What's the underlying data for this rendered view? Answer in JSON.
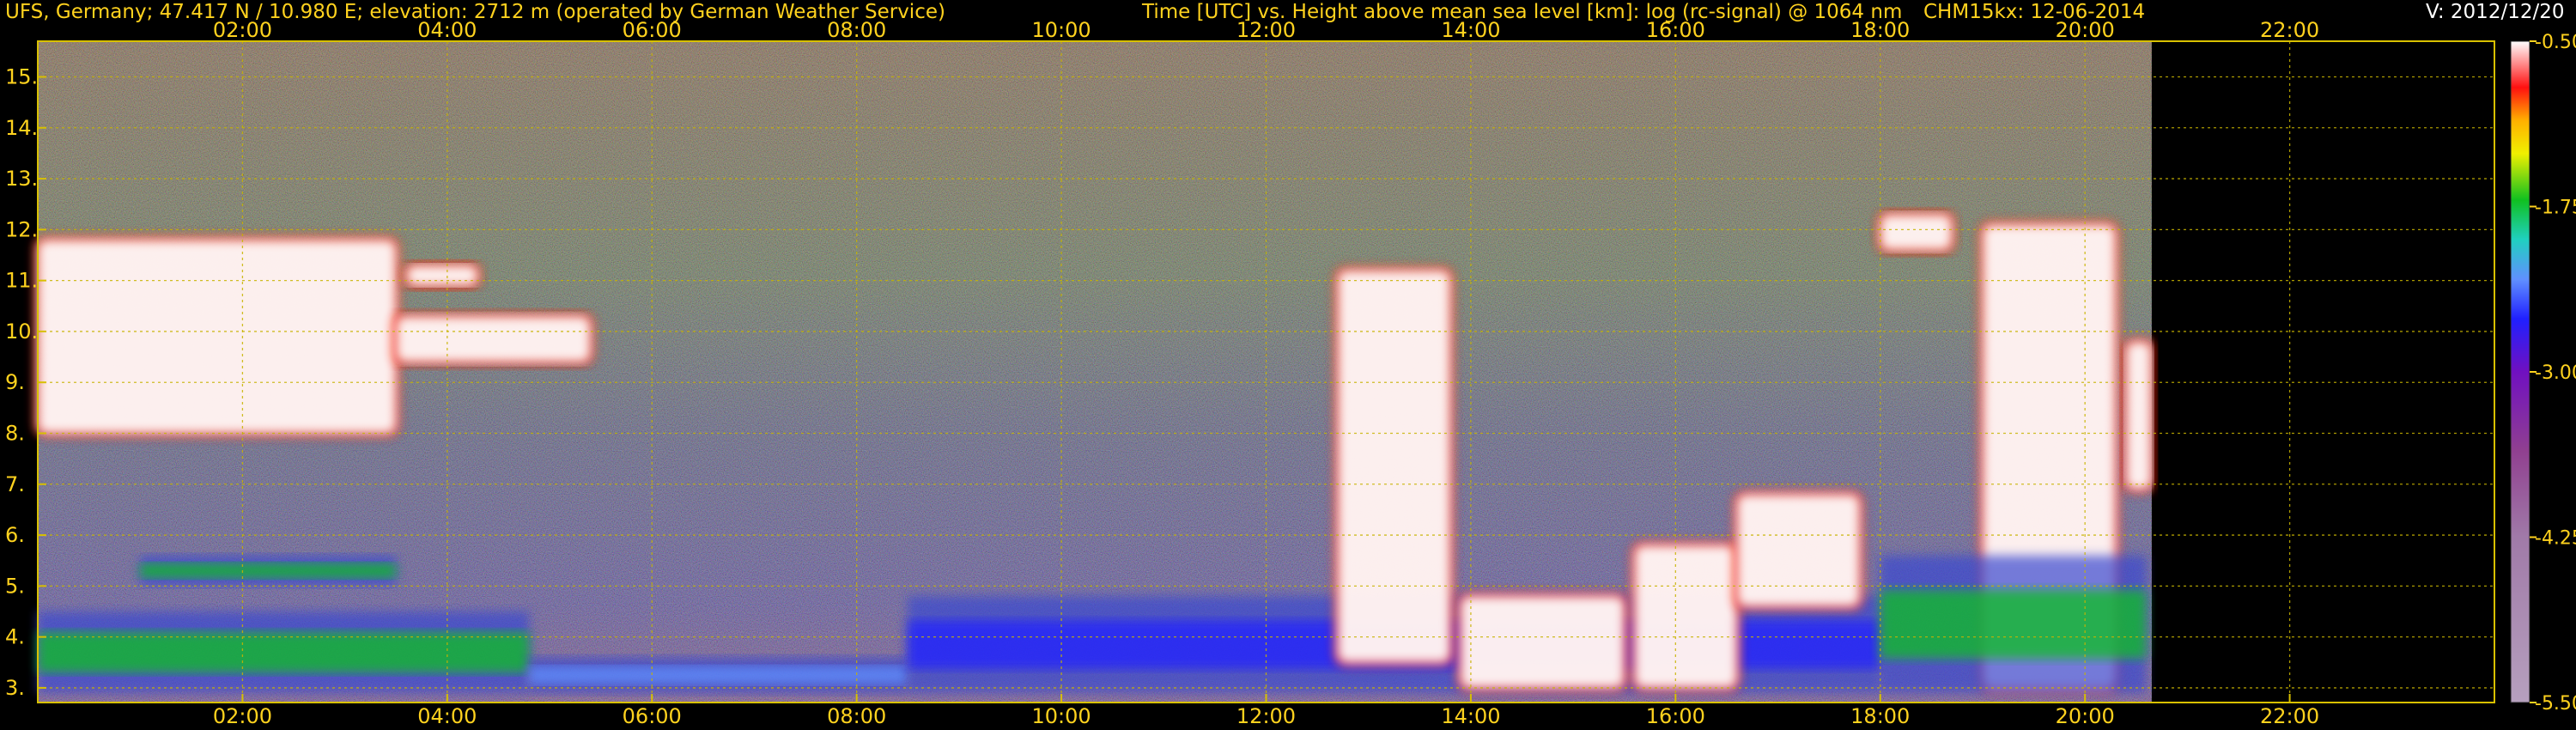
{
  "header": {
    "station": "UFS, Germany; 47.417 N / 10.980 E; elevation: 2712 m  (operated by German Weather Service)",
    "plot_title": "Time [UTC] vs. Height above mean sea level [km]: log (rc-signal) @ 1064 nm",
    "instrument_date": "CHM15kx: 12-06-2014",
    "version": "V: 2012/12/20"
  },
  "chart_data": {
    "type": "heatmap",
    "title": "Time [UTC] vs. Height above mean sea level [km]: log (rc-signal) @ 1064 nm",
    "xlabel": "Time [UTC]",
    "ylabel": "Height above mean sea level [km]",
    "x_unit": "hours UTC",
    "xlim": [
      0.0,
      24.0
    ],
    "ylim": [
      2.712,
      15.7
    ],
    "x_ticks": [
      {
        "value": 2,
        "label": "02:00"
      },
      {
        "value": 4,
        "label": "04:00"
      },
      {
        "value": 6,
        "label": "06:00"
      },
      {
        "value": 8,
        "label": "08:00"
      },
      {
        "value": 10,
        "label": "10:00"
      },
      {
        "value": 12,
        "label": "12:00"
      },
      {
        "value": 14,
        "label": "14:00"
      },
      {
        "value": 16,
        "label": "16:00"
      },
      {
        "value": 18,
        "label": "18:00"
      },
      {
        "value": 20,
        "label": "20:00"
      },
      {
        "value": 22,
        "label": "22:00"
      }
    ],
    "y_ticks": [
      {
        "value": 3,
        "label": "3."
      },
      {
        "value": 4,
        "label": "4."
      },
      {
        "value": 5,
        "label": "5."
      },
      {
        "value": 6,
        "label": "6."
      },
      {
        "value": 7,
        "label": "7."
      },
      {
        "value": 8,
        "label": "8."
      },
      {
        "value": 9,
        "label": "9."
      },
      {
        "value": 10,
        "label": "10."
      },
      {
        "value": 11,
        "label": "11."
      },
      {
        "value": 12,
        "label": "12."
      },
      {
        "value": 13,
        "label": "13."
      },
      {
        "value": 14,
        "label": "14."
      },
      {
        "value": 15,
        "label": "15."
      }
    ],
    "grid": true,
    "data_end_time": 20.65,
    "colorbar": {
      "range": [
        -5.5,
        -0.5
      ],
      "ticks": [
        {
          "value": -0.5,
          "label": "-0.50"
        },
        {
          "value": -1.75,
          "label": "-1.75"
        },
        {
          "value": -3.0,
          "label": "-3.00"
        },
        {
          "value": -4.25,
          "label": "-4.25"
        },
        {
          "value": -5.5,
          "label": "-5.50"
        }
      ],
      "stops": [
        {
          "value": -0.5,
          "color": "#ffffff"
        },
        {
          "value": -0.85,
          "color": "#ff1010"
        },
        {
          "value": -1.1,
          "color": "#ffb000"
        },
        {
          "value": -1.35,
          "color": "#f0f000"
        },
        {
          "value": -1.7,
          "color": "#10c020"
        },
        {
          "value": -2.0,
          "color": "#20d0c0"
        },
        {
          "value": -2.3,
          "color": "#6090ff"
        },
        {
          "value": -2.6,
          "color": "#2020ff"
        },
        {
          "value": -3.0,
          "color": "#7010c0"
        },
        {
          "value": -3.6,
          "color": "#904090"
        },
        {
          "value": -4.25,
          "color": "#a07aa8"
        },
        {
          "value": -5.5,
          "color": "#b6a0be"
        }
      ]
    },
    "features": [
      {
        "kind": "cloud",
        "start": 0.0,
        "end": 3.5,
        "bottom": 8.0,
        "top": 11.8,
        "max_signal": -0.5
      },
      {
        "kind": "cloud",
        "start": 3.5,
        "end": 5.4,
        "bottom": 9.4,
        "top": 10.3,
        "max_signal": -0.5
      },
      {
        "kind": "cloud",
        "start": 3.6,
        "end": 4.3,
        "bottom": 10.9,
        "top": 11.3,
        "max_signal": -0.5
      },
      {
        "kind": "boundary_layer",
        "start": 0.0,
        "end": 4.8,
        "bottom": 2.9,
        "top": 4.5,
        "max_signal": -1.8
      },
      {
        "kind": "boundary_layer",
        "start": 1.0,
        "end": 3.5,
        "bottom": 5.0,
        "top": 5.6,
        "max_signal": -2.0
      },
      {
        "kind": "boundary_layer",
        "start": 4.8,
        "end": 8.5,
        "bottom": 2.9,
        "top": 3.6,
        "max_signal": -2.4
      },
      {
        "kind": "boundary_layer",
        "start": 8.5,
        "end": 18.0,
        "bottom": 2.9,
        "top": 4.8,
        "max_signal": -3.0
      },
      {
        "kind": "cloud",
        "start": 12.7,
        "end": 13.8,
        "bottom": 3.5,
        "top": 11.2,
        "max_signal": -0.5
      },
      {
        "kind": "cloud",
        "start": 13.9,
        "end": 15.5,
        "bottom": 3.0,
        "top": 4.8,
        "max_signal": -0.5
      },
      {
        "kind": "cloud",
        "start": 15.6,
        "end": 16.6,
        "bottom": 3.0,
        "top": 5.8,
        "max_signal": -0.5
      },
      {
        "kind": "cloud",
        "start": 16.6,
        "end": 17.8,
        "bottom": 4.6,
        "top": 6.8,
        "max_signal": -0.5
      },
      {
        "kind": "cloud",
        "start": 18.0,
        "end": 18.7,
        "bottom": 11.6,
        "top": 12.3,
        "max_signal": -0.5
      },
      {
        "kind": "cloud",
        "start": 19.0,
        "end": 20.3,
        "bottom": 3.0,
        "top": 12.1,
        "max_signal": -0.5
      },
      {
        "kind": "boundary_layer",
        "start": 18.0,
        "end": 20.6,
        "bottom": 2.9,
        "top": 5.6,
        "max_signal": -1.8
      },
      {
        "kind": "cloud",
        "start": 20.4,
        "end": 20.65,
        "bottom": 6.9,
        "top": 9.8,
        "max_signal": -0.5
      }
    ]
  }
}
